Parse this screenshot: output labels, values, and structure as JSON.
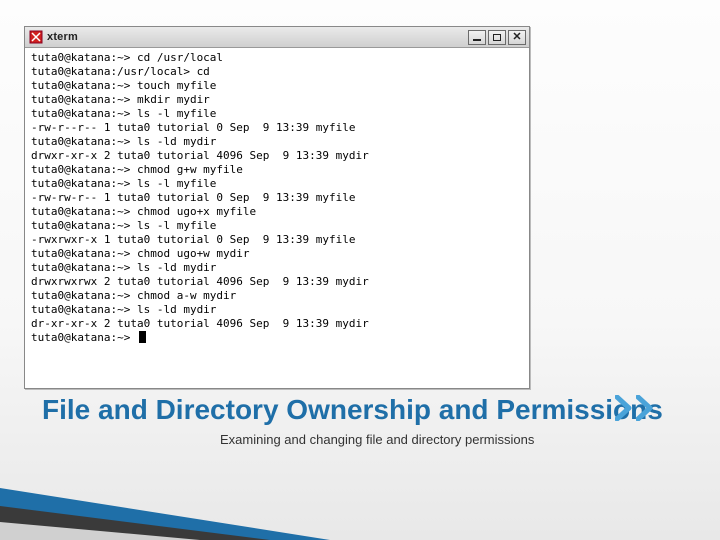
{
  "window": {
    "title": "xterm",
    "icon": "xterm-icon"
  },
  "terminal": {
    "lines": [
      "tuta0@katana:~> cd /usr/local",
      "tuta0@katana:/usr/local> cd",
      "tuta0@katana:~> touch myfile",
      "tuta0@katana:~> mkdir mydir",
      "tuta0@katana:~> ls -l myfile",
      "-rw-r--r-- 1 tuta0 tutorial 0 Sep  9 13:39 myfile",
      "tuta0@katana:~> ls -ld mydir",
      "drwxr-xr-x 2 tuta0 tutorial 4096 Sep  9 13:39 mydir",
      "tuta0@katana:~> chmod g+w myfile",
      "tuta0@katana:~> ls -l myfile",
      "-rw-rw-r-- 1 tuta0 tutorial 0 Sep  9 13:39 myfile",
      "tuta0@katana:~> chmod ugo+x myfile",
      "tuta0@katana:~> ls -l myfile",
      "-rwxrwxr-x 1 tuta0 tutorial 0 Sep  9 13:39 myfile",
      "tuta0@katana:~> chmod ugo+w mydir",
      "tuta0@katana:~> ls -ld mydir",
      "drwxrwxrwx 2 tuta0 tutorial 4096 Sep  9 13:39 mydir",
      "tuta0@katana:~> chmod a-w mydir",
      "tuta0@katana:~> ls -ld mydir",
      "dr-xr-xr-x 2 tuta0 tutorial 4096 Sep  9 13:39 mydir",
      "tuta0@katana:~> "
    ]
  },
  "slide": {
    "title": "File and Directory Ownership and Permissions",
    "subtitle": "Examining and changing file and directory permissions"
  },
  "colors": {
    "accent": "#1f6fa8",
    "chevron": "#4aa3d9"
  }
}
